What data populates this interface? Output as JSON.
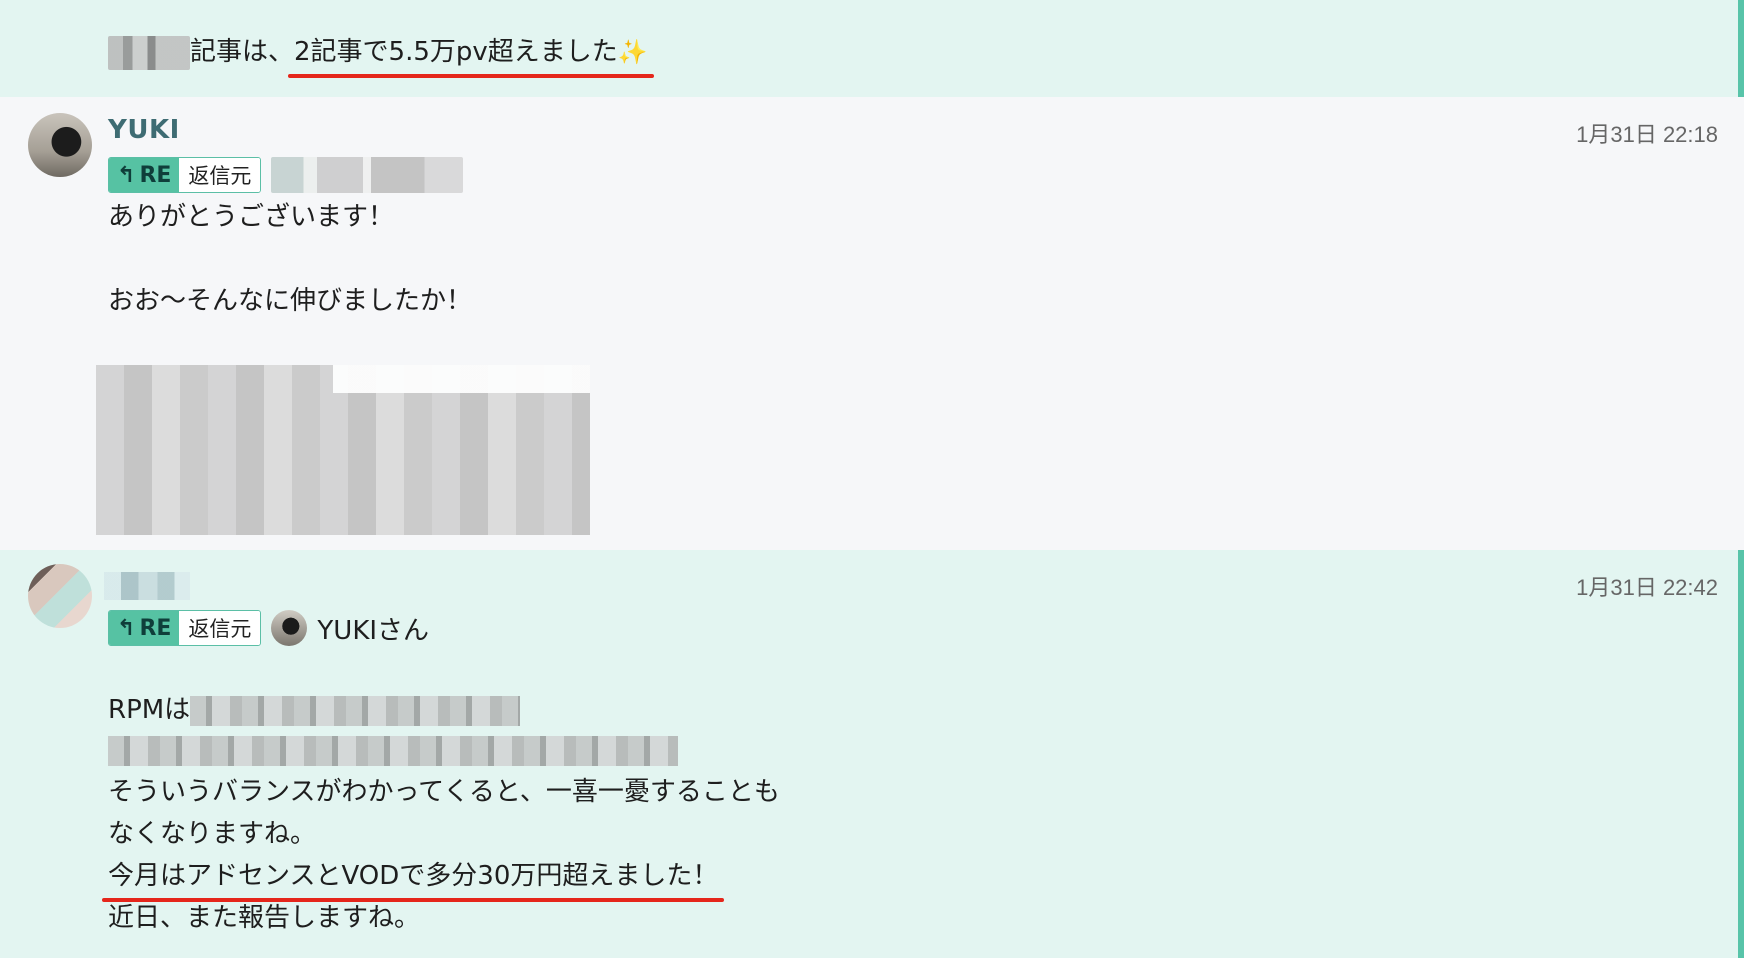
{
  "messages": [
    {
      "text_suffix": "記事は、",
      "highlight": "2記事で5.5万pv超えました",
      "emoji": "✨"
    },
    {
      "author": "YUKI",
      "timestamp": "1月31日 22:18",
      "reply_badge": "RE",
      "reply_label": "返信元",
      "lines": [
        "ありがとうございます！",
        "おお〜そんなに伸びましたか！"
      ]
    },
    {
      "timestamp": "1月31日 22:42",
      "reply_badge": "RE",
      "reply_label": "返信元",
      "reply_to": "YUKIさん",
      "rpm_prefix": "RPMは",
      "lines": [
        "そういうバランスがわかってくると、一喜一憂することも",
        "なくなりますね。"
      ],
      "highlight": "今月はアドセンスとVODで多分30万円超えました！",
      "closing": "近日、また報告しますね。"
    }
  ],
  "colors": {
    "accent": "#56c2a3",
    "highlight_underline": "#e5261b",
    "username": "#3e6c73",
    "bg_mint": "#e3f5f1",
    "bg_gray": "#f6f7f9"
  },
  "icons": [
    "reply-arrow-icon",
    "sparkles-icon"
  ]
}
